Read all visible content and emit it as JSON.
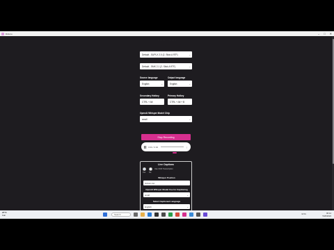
{
  "window": {
    "title": "Dictoru"
  },
  "faded_header": "· · · · · · · · · · · · · · ·",
  "input_device": {
    "value": "Default - SUPLX 2.0 (2- Stick A 9TF)"
  },
  "output_device": {
    "value": "Default - SMK 2.1 (2- Stick A 9TF)"
  },
  "source_language": {
    "label": "Source language",
    "value": "English"
  },
  "output_language": {
    "label": "Output language",
    "value": "English"
  },
  "secondary_hotkey": {
    "label": "Secondary Hotkey",
    "value": "CTRL + Alt"
  },
  "primary_hotkey": {
    "label": "Primary Hotkey",
    "value": "CTRL + Alt + B"
  },
  "whisper_model": {
    "label": "OpenAI Whisper Model Chip",
    "value": "small"
  },
  "stop_button": "Stop Recording",
  "player": {
    "time": "0:00 / 0:00",
    "dots": "⋮"
  },
  "live_captions": {
    "title": "Live Captions",
    "radio_yes": "Yes",
    "radio_no": "No",
    "radio_caption": "Use OCR Transcription",
    "position_label": "Whisper Position",
    "position_value": "bottom-top",
    "model_label": "OpenAI Whisper Model Use for Captioning",
    "model_value": "small",
    "language_label": "Select Captioned Language",
    "language_value": "English"
  },
  "taskbar": {
    "weather_temp": "27°C",
    "weather_desc": "Fair",
    "search_placeholder": "Search",
    "time": "06:12",
    "date": "5/26/2024",
    "tray": "ENG"
  },
  "colors": {
    "accent": "#d62f8e",
    "background": "#1e1c20"
  }
}
